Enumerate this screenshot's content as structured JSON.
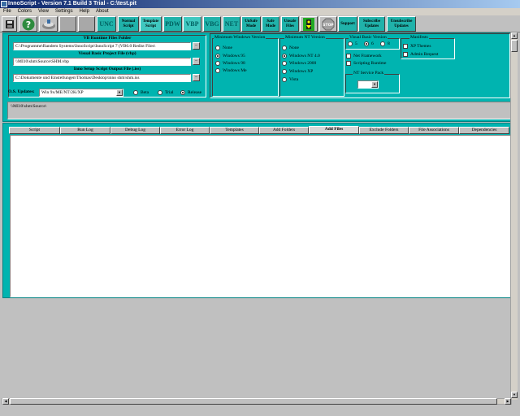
{
  "window": {
    "title": "InnoScript - Version 7.1  Build 3  Trial - C:\\test.pit"
  },
  "menu": [
    "File",
    "Colors",
    "View",
    "Settings",
    "Help",
    "About"
  ],
  "toolbar": {
    "unc": "UNC",
    "normal_script": "Normal Script",
    "template_script": "Template Script",
    "pdw": "PDW",
    "vbp": "VBP",
    "vbg": "VBG",
    "net": "NET",
    "unsafe_mode": "UnSafe Mode",
    "safe_mode": "Safe Mode",
    "unsafe_files": "Unsafe Files",
    "stop": "STOP",
    "support": "Support",
    "subscribe_updates": "Subscribe Updates",
    "unsubscribe_updates": "Unsubscribe Updates"
  },
  "paths": {
    "vb_runtime_label": "VB Runtime Files Folder",
    "vb_runtime_value": "C:\\Programme\\Randem Systems\\InnoScript\\InnoScript 7 (VB6.0 Redist Files\\",
    "vbp_label": "Visual Basic Project File (vbp)",
    "vbp_value": "\\\\MI10\\shm\\Source\\SHM.vbp",
    "iss_label": "Inno Setup Script Output File (.iss)",
    "iss_value": "C:\\Dokumente und Einstellungen\\Thomas\\Desktop\\inno shm\\shm.iss",
    "browse": "..."
  },
  "os_updates": {
    "label": "O.S. Updates:",
    "selected": "Win 9x/ME/NT/2K/XP",
    "modes": [
      "Beta",
      "Trial",
      "Release"
    ],
    "active_mode": "Release"
  },
  "min_windows": {
    "title": "Minimum Windows Version",
    "options": [
      "None",
      "Windows 95",
      "Windows 98",
      "Windows Me"
    ],
    "selected": "Windows 95"
  },
  "min_nt": {
    "title": "Minimum NT Version",
    "options": [
      "None",
      "Windows NT 4.0",
      "Windows 2000",
      "Windows XP",
      "Vista"
    ],
    "selected": "Windows NT 4.0"
  },
  "vb_version": {
    "title": "Visual Basic Version",
    "options": [
      "5",
      "6",
      "8"
    ],
    "selected": "6"
  },
  "net_options": {
    "net_framework": "Net Framework",
    "scripting_runtime": "Scripting Runtime"
  },
  "service_pack": {
    "title": "NT Service Pack",
    "value": ""
  },
  "manifests": {
    "title": "Manifests",
    "xp_themes": "XP Themes",
    "admin_request": "Admin Request"
  },
  "source_dir": "\\\\MI10\\shm\\Source\\",
  "tabs": [
    "Script",
    "Run Log",
    "Debug Log",
    "Error Log",
    "Templates",
    "Add Folders",
    "Add Files",
    "Exclude Folders",
    "File Associations",
    "Dependencies"
  ],
  "active_tab": "Add Files"
}
